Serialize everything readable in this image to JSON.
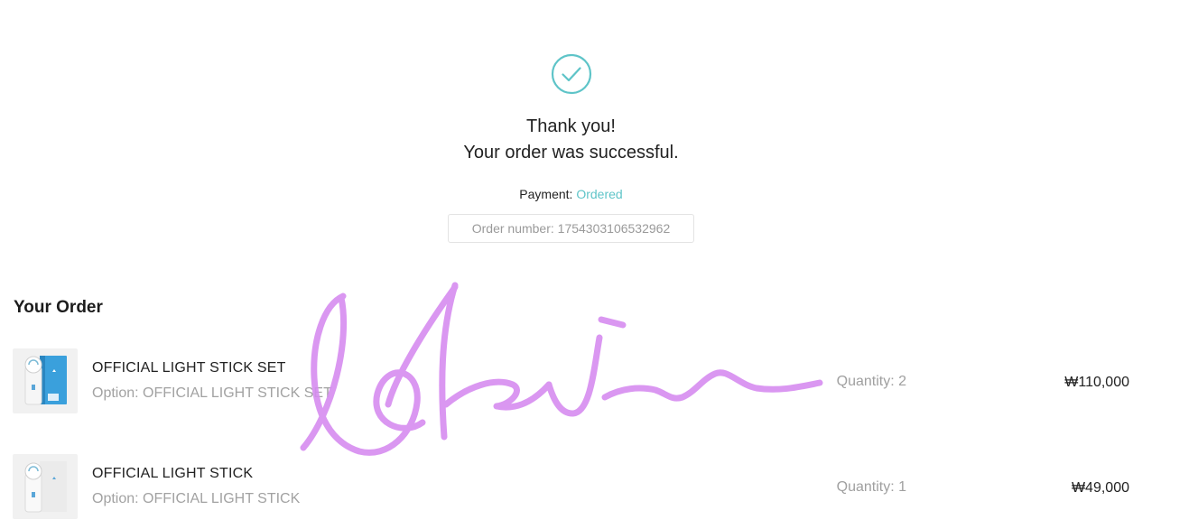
{
  "confirmation": {
    "thanks_line1": "Thank you!",
    "thanks_line2": "Your order was successful.",
    "payment_label": "Payment:",
    "payment_status": "Ordered",
    "order_number": "Order number: 1754303106532962",
    "icon": "check-circle-icon"
  },
  "order": {
    "heading": "Your Order",
    "items": [
      {
        "name": "OFFICIAL LIGHT STICK SET",
        "option": "Option: OFFICIAL LIGHT STICK SET",
        "quantity": "Quantity: 2",
        "price": "₩110,000"
      },
      {
        "name": "OFFICIAL LIGHT STICK",
        "option": "Option: OFFICIAL LIGHT STICK",
        "quantity": "Quantity: 1",
        "price": "₩49,000"
      }
    ]
  },
  "colors": {
    "accent": "#5ec4c8",
    "signature": "#d68cf0"
  }
}
